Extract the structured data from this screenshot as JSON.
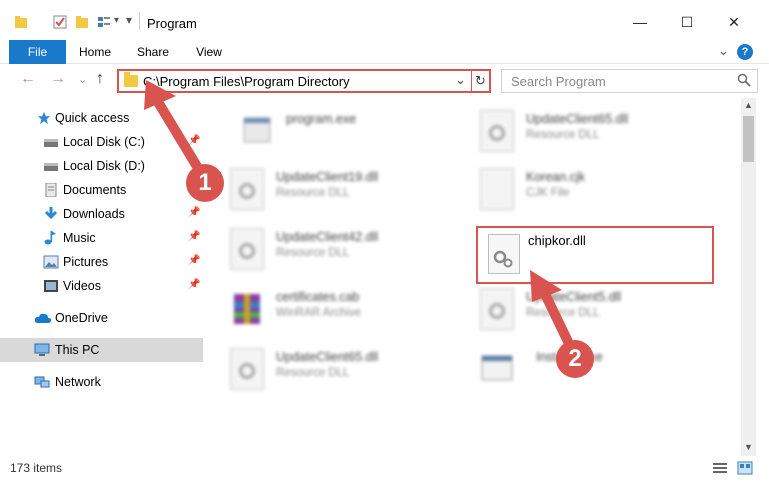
{
  "window": {
    "title": "Program",
    "minimize": "—",
    "maximize": "☐",
    "close": "✕"
  },
  "ribbon": {
    "tabs": [
      "File",
      "Home",
      "Share",
      "View"
    ],
    "expand": "⌄",
    "help": "?"
  },
  "nav": {
    "back": "←",
    "forward": "→",
    "recent": "⌄",
    "up": "↑",
    "address": "C:\\Program Files\\Program Directory",
    "address_dropdown": "⌄",
    "refresh": "↻",
    "search_placeholder": "Search Program"
  },
  "sidebar": {
    "items": [
      {
        "label": "Quick access",
        "icon": "star-icon",
        "pinned": false
      },
      {
        "label": "Local Disk (C:)",
        "icon": "drive-icon",
        "pinned": true
      },
      {
        "label": "Local Disk (D:)",
        "icon": "drive-icon",
        "pinned": false
      },
      {
        "label": "Documents",
        "icon": "documents-icon",
        "pinned": true
      },
      {
        "label": "Downloads",
        "icon": "download-icon",
        "pinned": true
      },
      {
        "label": "Music",
        "icon": "music-icon",
        "pinned": true
      },
      {
        "label": "Pictures",
        "icon": "pictures-icon",
        "pinned": true
      },
      {
        "label": "Videos",
        "icon": "videos-icon",
        "pinned": true
      },
      {
        "label": "OneDrive",
        "icon": "cloud-icon",
        "pinned": false
      },
      {
        "label": "This PC",
        "icon": "computer-icon",
        "pinned": false,
        "selected": true
      },
      {
        "label": "Network",
        "icon": "network-icon",
        "pinned": false
      }
    ],
    "pin_glyph": "📌"
  },
  "files": [
    {
      "name": "program.exe",
      "type": "",
      "icon": "exe-icon"
    },
    {
      "name": "UpdateClient65.dll",
      "type": "Resource DLL",
      "icon": "dll-icon"
    },
    {
      "name": "UpdateClient19.dll",
      "type": "Resource DLL",
      "icon": "dll-icon"
    },
    {
      "name": "Korean.cjk",
      "type": "CJK File",
      "icon": "document-icon"
    },
    {
      "name": "UpdateClient42.dll",
      "type": "Resource DLL",
      "icon": "dll-icon"
    },
    {
      "name": "certificates.cab",
      "type": "WinRAR Archive",
      "icon": "archive-icon"
    },
    {
      "name": "UpdateClient5.dll",
      "type": "Resource DLL",
      "icon": "dll-icon"
    },
    {
      "name": "UpdateClient65.dll",
      "type": "Resource DLL",
      "icon": "dll-icon"
    },
    {
      "name": "Installer.exe",
      "type": "",
      "icon": "installer-icon"
    }
  ],
  "highlighted_file": {
    "name": "chipkor.dll",
    "icon": "dll-gear-icon"
  },
  "callouts": [
    "1",
    "2"
  ],
  "status": {
    "item_count": "173 items"
  },
  "colors": {
    "accent": "#1979ca",
    "callout": "#d9534f",
    "selected": "#d9d9d9"
  }
}
